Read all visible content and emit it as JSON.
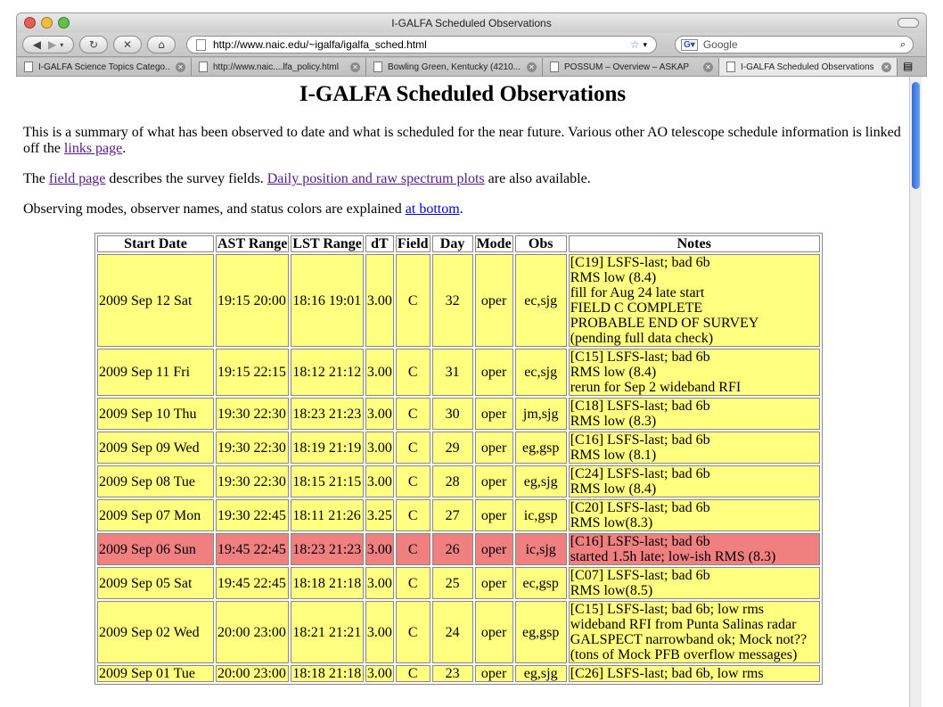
{
  "window": {
    "title": "I-GALFA Scheduled Observations"
  },
  "toolbar": {
    "url": "http://www.naic.edu/~igalfa/igalfa_sched.html",
    "search_placeholder": "Google"
  },
  "tabs": [
    {
      "label": "I-GALFA Science Topics Catego..."
    },
    {
      "label": "http://www.naic....lfa_policy.html"
    },
    {
      "label": "Bowling Green, Kentucky (4210..."
    },
    {
      "label": "POSSUM – Overview – ASKAP"
    },
    {
      "label": "I-GALFA Scheduled Observations"
    }
  ],
  "page": {
    "heading": "I-GALFA Scheduled Observations",
    "p1_text": "This is a summary of what has been observed to date and what is scheduled for the near future. Various other AO telescope schedule information is linked off the ",
    "p1_link": "links page",
    "p1_end": ".",
    "p2_start": "The ",
    "p2_link1": "field page",
    "p2_mid": " describes the survey fields. ",
    "p2_link2": "Daily position and raw spectrum plots",
    "p2_end": " are also available.",
    "p3_text": "Observing modes, observer names, and status colors are explained ",
    "p3_link": "at bottom",
    "p3_end": "."
  },
  "table": {
    "headers": [
      "Start Date",
      "AST Range",
      "LST Range",
      "dT",
      "Field",
      "Day",
      "Mode",
      "Obs",
      "Notes"
    ],
    "rows": [
      {
        "status": "yellow",
        "cells": [
          "2009 Sep 12 Sat",
          "19:15 20:00",
          "18:16 19:01",
          "3.00",
          "C",
          "32",
          "oper",
          "ec,sjg"
        ],
        "notes": [
          "[C19] LSFS-last; bad 6b",
          "RMS low (8.4)",
          "fill for Aug 24 late start",
          "FIELD C COMPLETE",
          "PROBABLE END OF SURVEY",
          "(pending full data check)"
        ]
      },
      {
        "status": "yellow",
        "cells": [
          "2009 Sep 11 Fri",
          "19:15 22:15",
          "18:12 21:12",
          "3.00",
          "C",
          "31",
          "oper",
          "ec,sjg"
        ],
        "notes": [
          "[C15] LSFS-last; bad 6b",
          "RMS low (8.4)",
          "rerun for Sep 2 wideband RFI"
        ]
      },
      {
        "status": "yellow",
        "cells": [
          "2009 Sep 10 Thu",
          "19:30 22:30",
          "18:23 21:23",
          "3.00",
          "C",
          "30",
          "oper",
          "jm,sjg"
        ],
        "notes": [
          "[C18] LSFS-last; bad 6b",
          "RMS low (8.3)"
        ]
      },
      {
        "status": "yellow",
        "cells": [
          "2009 Sep 09 Wed",
          "19:30 22:30",
          "18:19 21:19",
          "3.00",
          "C",
          "29",
          "oper",
          "eg,gsp"
        ],
        "notes": [
          "[C16] LSFS-last; bad 6b",
          "RMS low (8.1)"
        ]
      },
      {
        "status": "yellow",
        "cells": [
          "2009 Sep 08 Tue",
          "19:30 22:30",
          "18:15 21:15",
          "3.00",
          "C",
          "28",
          "oper",
          "eg,sjg"
        ],
        "notes": [
          "[C24] LSFS-last; bad 6b",
          "RMS low (8.4)"
        ]
      },
      {
        "status": "yellow",
        "cells": [
          "2009 Sep 07 Mon",
          "19:30 22:45",
          "18:11 21:26",
          "3.25",
          "C",
          "27",
          "oper",
          "ic,gsp"
        ],
        "notes": [
          "[C20] LSFS-last; bad 6b",
          "RMS low(8.3)"
        ]
      },
      {
        "status": "red",
        "cells": [
          "2009 Sep 06 Sun",
          "19:45 22:45",
          "18:23 21:23",
          "3.00",
          "C",
          "26",
          "oper",
          "ic,sjg"
        ],
        "notes": [
          "[C16] LSFS-last; bad 6b",
          "started 1.5h late; low-ish RMS (8.3)"
        ]
      },
      {
        "status": "yellow",
        "cells": [
          "2009 Sep 05 Sat",
          "19:45 22:45",
          "18:18 21:18",
          "3.00",
          "C",
          "25",
          "oper",
          "ec,gsp"
        ],
        "notes": [
          "[C07] LSFS-last; bad 6b",
          "RMS low(8.5)"
        ]
      },
      {
        "status": "yellow",
        "cells": [
          "2009 Sep 02 Wed",
          "20:00 23:00",
          "18:21 21:21",
          "3.00",
          "C",
          "24",
          "oper",
          "eg,gsp"
        ],
        "notes": [
          "[C15] LSFS-last; bad 6b; low rms",
          "wideband RFI from Punta Salinas radar",
          "GALSPECT narrowband ok; Mock not??",
          "(tons of Mock PFB overflow messages)"
        ]
      },
      {
        "status": "yellow",
        "cells": [
          "2009 Sep 01 Tue",
          "20:00 23:00",
          "18:18 21:18",
          "3.00",
          "C",
          "23",
          "oper",
          "eg,sjg"
        ],
        "notes": [
          "[C26] LSFS-last; bad 6b, low rms"
        ]
      }
    ]
  },
  "colors": {
    "yellow_row": "#ffff80",
    "red_row": "#f08080",
    "link_visited": "#551a8b",
    "link": "#0000ee"
  }
}
